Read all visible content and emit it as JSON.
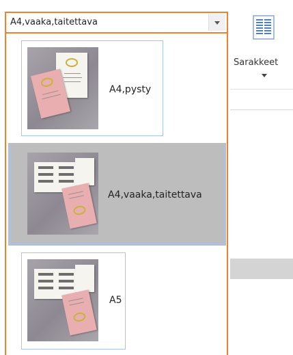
{
  "ribbon": {
    "columns_label": "Sarakkeet",
    "columns_icon": "columns-icon"
  },
  "dropdown": {
    "selected_value": "A4,vaaka,taitettava",
    "arrow_icon": "chevron-down-icon",
    "accent_color": "#f07f2e",
    "selected_row_color": "#bdbdbd"
  },
  "options": [
    {
      "label": "A4,pysty",
      "icon": "portrait-booklet-thumbnail",
      "selected": false
    },
    {
      "label": "A4,vaaka,taitettava",
      "icon": "landscape-folded-thumbnail",
      "selected": true
    },
    {
      "label": "A5",
      "icon": "a5-thumbnail",
      "selected": false
    }
  ]
}
